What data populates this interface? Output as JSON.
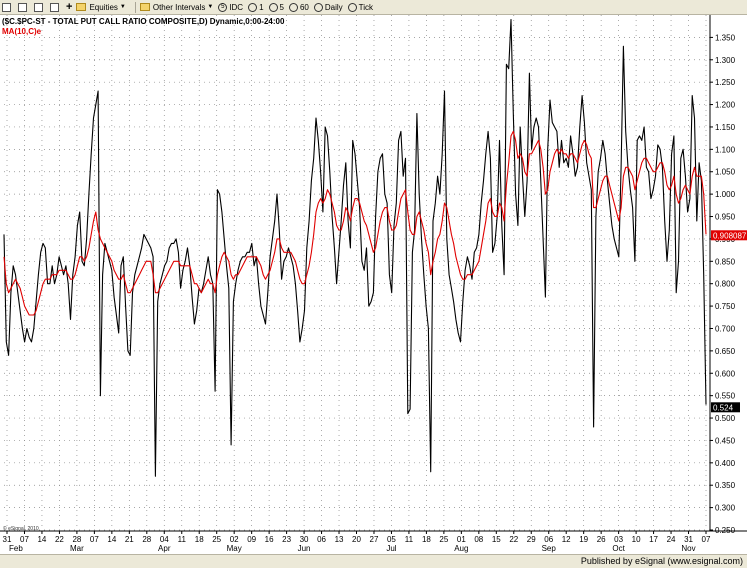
{
  "toolbar": {
    "equities": "Equities",
    "other_intervals": "Other Intervals",
    "idc": "IDC",
    "int_1": "1",
    "int_5": "5",
    "int_60": "60",
    "daily": "Daily",
    "tick": "Tick"
  },
  "header": {
    "title": "($C.$PC-ST - TOTAL PUT CALL RATIO COMPOSITE,D) Dynamic,0:00-24:00",
    "ma_label": "MA(10,C)e"
  },
  "copyright": "© eSignal, 2010",
  "footer": {
    "text": "Published by eSignal (www.esignal.com)"
  },
  "colors": {
    "price": "#000000",
    "ma": "#e00000",
    "grid": "#888888",
    "last_badge_bg": "#000000",
    "ma_badge_bg": "#e00000"
  },
  "chart_data": {
    "type": "line",
    "y_axis": {
      "min": 0.25,
      "max": 1.4,
      "ticks": [
        "0.250",
        "0.300",
        "0.350",
        "0.400",
        "0.450",
        "0.500",
        "0.550",
        "0.600",
        "0.650",
        "0.700",
        "0.750",
        "0.800",
        "0.850",
        "0.900",
        "0.950",
        "1.000",
        "1.050",
        "1.100",
        "1.150",
        "1.200",
        "1.250",
        "1.300",
        "1.350"
      ]
    },
    "x_day_labels": [
      "31",
      "07",
      "14",
      "22",
      "28",
      "07",
      "14",
      "21",
      "28",
      "04",
      "11",
      "18",
      "25",
      "02",
      "09",
      "16",
      "23",
      "30",
      "06",
      "13",
      "20",
      "27",
      "05",
      "11",
      "18",
      "25",
      "01",
      "08",
      "15",
      "22",
      "29",
      "06",
      "12",
      "19",
      "26",
      "03",
      "10",
      "17",
      "24",
      "31",
      "07"
    ],
    "x_month_labels": [
      {
        "label": "Feb",
        "index": 0
      },
      {
        "label": "Mar",
        "index": 4
      },
      {
        "label": "Apr",
        "index": 9
      },
      {
        "label": "May",
        "index": 13
      },
      {
        "label": "Jun",
        "index": 17
      },
      {
        "label": "Jul",
        "index": 22
      },
      {
        "label": "Aug",
        "index": 26
      },
      {
        "label": "Sep",
        "index": 31
      },
      {
        "label": "Oct",
        "index": 35
      },
      {
        "label": "Nov",
        "index": 39
      }
    ],
    "series": [
      {
        "values": [
          0.91,
          0.67,
          0.64,
          0.78,
          0.84,
          0.82,
          0.78,
          0.74,
          0.7,
          0.67,
          0.7,
          0.68,
          0.67,
          0.7,
          0.76,
          0.82,
          0.87,
          0.89,
          0.88,
          0.8,
          0.8,
          0.84,
          0.8,
          0.82,
          0.86,
          0.84,
          0.82,
          0.84,
          0.8,
          0.72,
          0.82,
          0.86,
          0.93,
          0.96,
          0.85,
          0.84,
          0.9,
          1.0,
          1.09,
          1.17,
          1.2,
          1.23,
          0.55,
          0.82,
          0.89,
          0.87,
          0.85,
          0.83,
          0.77,
          0.73,
          0.69,
          0.84,
          0.86,
          0.75,
          0.65,
          0.64,
          0.78,
          0.82,
          0.84,
          0.86,
          0.88,
          0.91,
          0.9,
          0.89,
          0.88,
          0.86,
          0.37,
          0.76,
          0.8,
          0.82,
          0.84,
          0.85,
          0.88,
          0.89,
          0.89,
          0.9,
          0.87,
          0.79,
          0.83,
          0.85,
          0.88,
          0.84,
          0.77,
          0.71,
          0.74,
          0.79,
          0.78,
          0.8,
          0.83,
          0.86,
          0.82,
          0.8,
          0.56,
          1.01,
          1.0,
          0.96,
          0.9,
          0.84,
          0.79,
          0.44,
          0.76,
          0.8,
          0.83,
          0.85,
          0.86,
          0.86,
          0.87,
          0.87,
          0.89,
          0.84,
          0.86,
          0.8,
          0.75,
          0.73,
          0.71,
          0.78,
          0.86,
          0.9,
          0.94,
          1.0,
          0.92,
          0.81,
          0.85,
          0.86,
          0.88,
          0.86,
          0.84,
          0.8,
          0.74,
          0.67,
          0.7,
          0.74,
          0.88,
          0.94,
          1.03,
          1.08,
          1.17,
          1.12,
          1.05,
          0.96,
          1.15,
          1.13,
          1.05,
          0.95,
          0.88,
          0.8,
          0.87,
          0.94,
          1.02,
          1.07,
          0.94,
          0.88,
          1.12,
          1.09,
          1.03,
          0.97,
          0.85,
          0.83,
          0.88,
          0.75,
          0.76,
          0.78,
          0.95,
          1.05,
          1.08,
          1.09,
          1.0,
          0.98,
          0.82,
          0.78,
          0.93,
          0.98,
          1.12,
          1.14,
          1.04,
          1.08,
          0.51,
          0.52,
          0.87,
          0.92,
          1.18,
          1.0,
          0.9,
          0.82,
          0.75,
          0.7,
          0.38,
          0.94,
          0.98,
          1.04,
          1.0,
          1.09,
          1.23,
          0.9,
          0.82,
          0.79,
          0.76,
          0.72,
          0.69,
          0.67,
          0.76,
          0.83,
          0.86,
          0.84,
          0.81,
          0.87,
          0.88,
          0.91,
          0.98,
          1.03,
          1.09,
          1.14,
          1.08,
          0.87,
          0.89,
          0.95,
          1.12,
          0.93,
          0.82,
          1.29,
          1.28,
          1.39,
          1.18,
          1.0,
          0.93,
          1.15,
          1.04,
          0.95,
          1.03,
          1.27,
          1.1,
          1.15,
          1.17,
          1.15,
          1.03,
          0.9,
          0.77,
          1.1,
          1.21,
          1.16,
          1.15,
          1.14,
          1.06,
          1.12,
          1.07,
          1.08,
          1.06,
          1.13,
          1.09,
          1.04,
          1.06,
          1.15,
          1.22,
          1.16,
          1.07,
          1.04,
          1.01,
          0.48,
          0.95,
          1.05,
          1.08,
          1.12,
          1.09,
          1.03,
          0.98,
          0.93,
          0.9,
          0.88,
          0.86,
          1.06,
          1.33,
          1.14,
          1.06,
          1.01,
          0.97,
          0.85,
          1.12,
          1.13,
          1.12,
          1.15,
          1.06,
          1.05,
          0.99,
          1.01,
          1.04,
          1.11,
          1.1,
          1.06,
          0.94,
          0.85,
          0.92,
          1.09,
          1.13,
          0.78,
          0.85,
          1.08,
          1.1,
          1.04,
          0.96,
          0.99,
          1.22,
          1.17,
          0.94,
          1.07,
          1.03,
          0.82,
          0.53
        ]
      },
      {
        "values": [
          0.86,
          0.8,
          0.78,
          0.79,
          0.8,
          0.81,
          0.8,
          0.79,
          0.77,
          0.75,
          0.74,
          0.73,
          0.73,
          0.73,
          0.74,
          0.76,
          0.78,
          0.8,
          0.81,
          0.81,
          0.81,
          0.82,
          0.82,
          0.82,
          0.83,
          0.83,
          0.83,
          0.83,
          0.82,
          0.81,
          0.81,
          0.82,
          0.84,
          0.86,
          0.86,
          0.85,
          0.86,
          0.88,
          0.91,
          0.94,
          0.96,
          0.92,
          0.9,
          0.89,
          0.88,
          0.87,
          0.86,
          0.85,
          0.83,
          0.82,
          0.81,
          0.81,
          0.82,
          0.8,
          0.78,
          0.78,
          0.79,
          0.8,
          0.81,
          0.82,
          0.83,
          0.84,
          0.85,
          0.85,
          0.85,
          0.82,
          0.78,
          0.78,
          0.79,
          0.8,
          0.81,
          0.82,
          0.83,
          0.84,
          0.85,
          0.85,
          0.85,
          0.84,
          0.84,
          0.84,
          0.84,
          0.84,
          0.82,
          0.8,
          0.8,
          0.79,
          0.78,
          0.79,
          0.8,
          0.81,
          0.8,
          0.8,
          0.78,
          0.82,
          0.84,
          0.86,
          0.87,
          0.86,
          0.85,
          0.82,
          0.81,
          0.82,
          0.82,
          0.83,
          0.84,
          0.85,
          0.86,
          0.86,
          0.86,
          0.86,
          0.86,
          0.85,
          0.84,
          0.82,
          0.81,
          0.82,
          0.83,
          0.85,
          0.87,
          0.9,
          0.9,
          0.88,
          0.87,
          0.87,
          0.87,
          0.87,
          0.86,
          0.85,
          0.83,
          0.81,
          0.8,
          0.8,
          0.82,
          0.84,
          0.87,
          0.91,
          0.96,
          0.98,
          0.99,
          0.98,
          0.99,
          1.01,
          1.0,
          0.98,
          0.96,
          0.93,
          0.92,
          0.92,
          0.94,
          0.97,
          0.96,
          0.94,
          0.97,
          0.99,
          0.99,
          0.98,
          0.96,
          0.94,
          0.93,
          0.91,
          0.89,
          0.87,
          0.88,
          0.91,
          0.94,
          0.96,
          0.97,
          0.97,
          0.94,
          0.92,
          0.92,
          0.93,
          0.96,
          0.99,
          1.0,
          1.01,
          0.96,
          0.92,
          0.91,
          0.91,
          0.95,
          0.96,
          0.94,
          0.92,
          0.89,
          0.87,
          0.82,
          0.85,
          0.87,
          0.9,
          0.91,
          0.94,
          0.98,
          0.97,
          0.94,
          0.91,
          0.89,
          0.86,
          0.84,
          0.82,
          0.81,
          0.81,
          0.82,
          0.82,
          0.82,
          0.83,
          0.84,
          0.85,
          0.88,
          0.91,
          0.94,
          0.98,
          0.99,
          0.96,
          0.95,
          0.95,
          0.98,
          0.97,
          0.94,
          1.02,
          1.07,
          1.13,
          1.14,
          1.12,
          1.08,
          1.09,
          1.08,
          1.05,
          1.04,
          1.09,
          1.09,
          1.1,
          1.11,
          1.12,
          1.1,
          1.06,
          1.0,
          1.01,
          1.05,
          1.07,
          1.09,
          1.1,
          1.09,
          1.1,
          1.09,
          1.09,
          1.08,
          1.09,
          1.09,
          1.08,
          1.07,
          1.09,
          1.11,
          1.12,
          1.11,
          1.09,
          1.08,
          0.97,
          0.97,
          0.99,
          1.01,
          1.03,
          1.04,
          1.04,
          1.02,
          1.0,
          0.98,
          0.96,
          0.94,
          0.97,
          1.04,
          1.06,
          1.06,
          1.05,
          1.04,
          1.01,
          1.03,
          1.05,
          1.07,
          1.08,
          1.08,
          1.07,
          1.06,
          1.05,
          1.05,
          1.06,
          1.07,
          1.07,
          1.05,
          1.02,
          1.01,
          1.02,
          1.04,
          1.0,
          0.98,
          0.99,
          1.01,
          1.02,
          1.01,
          1.0,
          1.04,
          1.06,
          1.04,
          1.04,
          1.04,
          1.0,
          0.91
        ]
      }
    ],
    "last_values": {
      "price": "0.524",
      "ma": "0.908087"
    }
  }
}
